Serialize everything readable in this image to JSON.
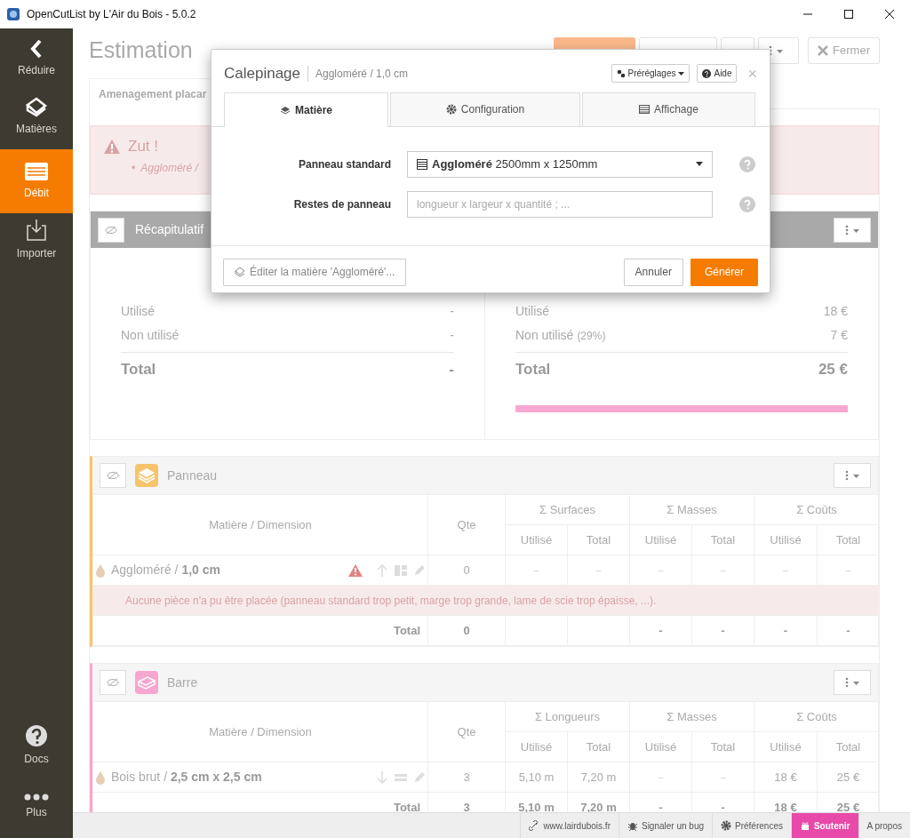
{
  "window": {
    "title": "OpenCutList by L'Air du Bois - 5.0.2"
  },
  "sidebar": {
    "items": [
      {
        "label": "Réduire",
        "kind": "collapse",
        "selected": false
      },
      {
        "label": "Matières",
        "kind": "materials",
        "selected": false
      },
      {
        "label": "Débit",
        "kind": "cutlist",
        "selected": true
      },
      {
        "label": "Importer",
        "kind": "import",
        "selected": false
      }
    ],
    "bottom_items": [
      {
        "label": "Docs",
        "kind": "docs"
      },
      {
        "label": "Plus",
        "kind": "more"
      }
    ]
  },
  "header": {
    "title": "Estimation",
    "close_button": "Fermer"
  },
  "tabs": [
    {
      "label": "Amenagement placar",
      "selected": true
    }
  ],
  "alert": {
    "title": "Zut !",
    "items": [
      {
        "marker": "•",
        "text": "Aggloméré /"
      }
    ]
  },
  "summary": {
    "title": "Récapitulatif",
    "left": [
      {
        "label": "Utilisé",
        "value": "-"
      },
      {
        "label": "Non utilisé",
        "value": "-"
      },
      {
        "label": "Total",
        "value": "-",
        "kind": "total"
      }
    ],
    "right": [
      {
        "label": "Utilisé",
        "value": "18 €"
      },
      {
        "label": "Non utilisé",
        "note": "(29%)",
        "value": "7 €"
      },
      {
        "label": "Total",
        "value": "25 €",
        "kind": "total"
      }
    ],
    "bar": {
      "level": 1
    }
  },
  "groups": [
    {
      "title": "Panneau",
      "kind": "sheet",
      "color": "#f7c46c",
      "columns": [
        "Matière / Dimension",
        "Qte"
      ],
      "measure_groups": [
        "Σ Surfaces",
        "Σ Masses",
        "Σ Coûts"
      ],
      "sub_columns": [
        "Utilisé",
        "Total",
        "Utilisé",
        "Total",
        "Utilisé",
        "Total"
      ],
      "rows": [
        {
          "label": "Aggloméré / **1,0 cm**",
          "warning": true,
          "qty": "0",
          "values": [
            "–",
            "–",
            "–",
            "–",
            "–",
            "–"
          ]
        }
      ],
      "error": "Aucune pièce n'a pu être placée (panneau standard trop petit, marge trop grande, lame de scie trop épaisse, ...).",
      "total": {
        "label": "Total",
        "qty": "0",
        "values": [
          "-",
          "-",
          "-",
          "-"
        ]
      }
    },
    {
      "title": "Barre",
      "kind": "bar",
      "color": "#f7a6cf",
      "columns": [
        "Matière / Dimension",
        "Qte"
      ],
      "measure_groups": [
        "Σ Longueurs",
        "Σ Masses",
        "Σ Coûts"
      ],
      "sub_columns": [
        "Utilisé",
        "Total",
        "Utilisé",
        "Total",
        "Utilisé",
        "Total"
      ],
      "rows": [
        {
          "label": "Bois brut / **2,5 cm x 2,5 cm**",
          "warning": false,
          "qty": "3",
          "values": [
            "5,10 m",
            "7,20 m",
            "–",
            "–",
            "18 €",
            "25 €"
          ]
        }
      ],
      "total": {
        "label": "Total",
        "qty": "3",
        "values": [
          "5,10 m",
          "7,20 m",
          "-",
          "-",
          "18 €",
          "25 €"
        ]
      }
    }
  ],
  "footer": [
    {
      "label": "www.lairdubois.fr",
      "kind": "link"
    },
    {
      "label": "Signaler un bug",
      "kind": "bug"
    },
    {
      "label": "Préférences",
      "kind": "prefs"
    },
    {
      "label": "Soutenir",
      "kind": "support"
    },
    {
      "label": "A propos",
      "kind": "about"
    }
  ],
  "dialog": {
    "title": "Calepinage",
    "subtitle": "Aggloméré / 1,0 cm",
    "presets_button": "Préréglages",
    "help_button": "Aide",
    "close": "×",
    "tabs": [
      {
        "label": "Matière",
        "kind": "material",
        "selected": true
      },
      {
        "label": "Configuration",
        "kind": "config",
        "selected": false
      },
      {
        "label": "Affichage",
        "kind": "display",
        "selected": false
      }
    ],
    "fields": [
      {
        "label": "Panneau standard",
        "kind": "select",
        "value": "**Aggloméré** 2500mm x 1250mm"
      },
      {
        "label": "Restes de panneau",
        "kind": "text",
        "placeholder": "longueur x largeur x quantité ; ..."
      }
    ],
    "edit_button": "Éditer la matière 'Aggloméré'...",
    "cancel_button": "Annuler",
    "generate_button": "Générer"
  }
}
